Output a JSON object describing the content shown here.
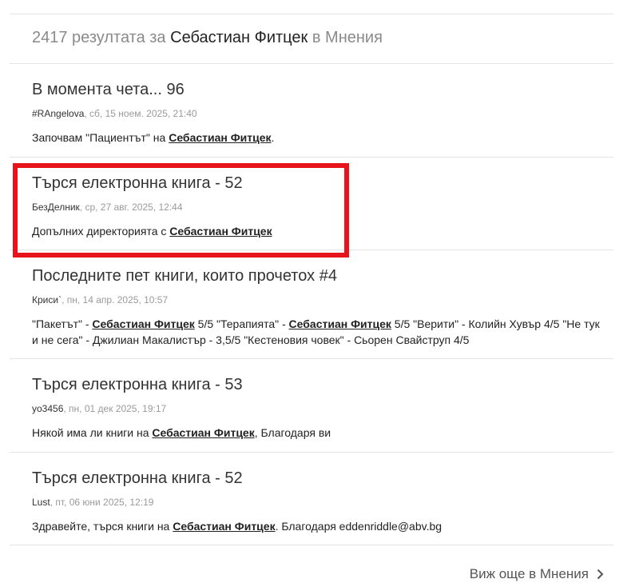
{
  "header": {
    "count_text": "2417 резултата за",
    "query": "Себастиан Фитцек",
    "in_text": "в Мнения"
  },
  "results": [
    {
      "title": "В момента чета... 96",
      "author": "#RAngelova",
      "datetime": ", сб, 15 ноем. 2025, 21:40",
      "snippet_pre": "Започвам \"Пациентът\" на ",
      "snippet_match": "Себастиан Фитцек",
      "snippet_post": "."
    },
    {
      "title": "Търся електронна книга - 52",
      "author": "БезДелник",
      "datetime": ", ср, 27 авг. 2025, 12:44",
      "snippet_pre": "Допълних директорията с ",
      "snippet_match": "Себастиан Фитцек",
      "snippet_post": ""
    },
    {
      "title": "Последните пет книги, които прочетох #4",
      "author": "Криси`",
      "datetime": ", пн, 14 апр. 2025, 10:57",
      "snippet_pre": "\"Пакетът\" - ",
      "snippet_match": "Себастиан Фитцек",
      "snippet_mid": " 5/5 \"Терапията\" - ",
      "snippet_match2": "Себастиан Фитцек",
      "snippet_post": " 5/5 \"Верити\" - Колийн Хувър 4/5 \"Не тук и не сега\" - Джилиан Макалистър - 3,5/5 \"Кестеновия човек\" - Сьорен Свайструп 4/5"
    },
    {
      "title": "Търся електронна книга - 53",
      "author": "yo3456",
      "datetime": ", пн, 01 дек 2025, 19:17",
      "snippet_pre": "Някой има ли книги на ",
      "snippet_match": "Себастиан Фитцек",
      "snippet_post": ", Благодаря ви"
    },
    {
      "title": "Търся електронна книга - 52",
      "author": "Lust",
      "datetime": ", пт, 06 юни 2025, 12:19",
      "snippet_pre": "Здравейте, търся книги на ",
      "snippet_match": "Себастиан Фитцек",
      "snippet_post": ". Благодаря eddenriddle@abv.bg"
    }
  ],
  "footer": {
    "more_label": "Виж още в Мнения"
  },
  "colors": {
    "highlight_border": "#e8141c"
  },
  "icons": {
    "more": "chevron-right-icon"
  }
}
